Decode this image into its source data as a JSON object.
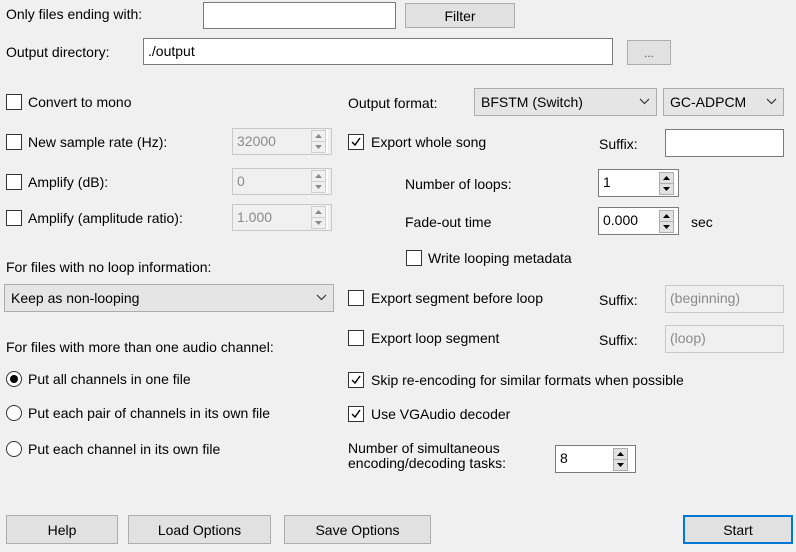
{
  "filter": {
    "label": "Only files ending with:",
    "value": "",
    "button": "Filter"
  },
  "output_dir": {
    "label": "Output directory:",
    "value": "./output",
    "browse": "..."
  },
  "convert_mono": {
    "label": "Convert to mono",
    "checked": false
  },
  "new_sample_rate": {
    "label": "New sample rate (Hz):",
    "value": "32000",
    "checked": false
  },
  "amplify_db": {
    "label": "Amplify (dB):",
    "value": "0",
    "checked": false
  },
  "amplify_ratio": {
    "label": "Amplify (amplitude ratio):",
    "value": "1.000",
    "checked": false
  },
  "no_loop": {
    "label": "For files with no loop information:",
    "selected": "Keep as non-looping"
  },
  "multi_channel": {
    "label": "For files with more than one audio channel:",
    "options": [
      "Put all channels in one file",
      "Put each pair of channels in its own file",
      "Put each channel in its own file"
    ],
    "selected_index": 0
  },
  "output_format": {
    "label": "Output format:",
    "format": "BFSTM (Switch)",
    "codec": "GC-ADPCM"
  },
  "export_whole": {
    "label": "Export whole song",
    "checked": true,
    "suffix_label": "Suffix:",
    "suffix_value": ""
  },
  "loops": {
    "label": "Number of loops:",
    "value": "1"
  },
  "fade": {
    "label": "Fade-out time",
    "value": "0.000",
    "unit": "sec"
  },
  "write_loop_meta": {
    "label": "Write looping metadata",
    "checked": false
  },
  "export_before": {
    "label": "Export segment before loop",
    "checked": false,
    "suffix_label": "Suffix:",
    "suffix_value": "(beginning)"
  },
  "export_loop": {
    "label": "Export loop segment",
    "checked": false,
    "suffix_label": "Suffix:",
    "suffix_value": "(loop)"
  },
  "skip_reencode": {
    "label": "Skip re-encoding for similar formats when possible",
    "checked": true
  },
  "vgaudio": {
    "label": "Use VGAudio decoder",
    "checked": true
  },
  "tasks": {
    "label_line1": "Number of simultaneous",
    "label_line2": "encoding/decoding tasks:",
    "value": "8"
  },
  "buttons": {
    "help": "Help",
    "load": "Load Options",
    "save": "Save Options",
    "start": "Start"
  },
  "colors": {
    "accent": "#0078d7",
    "background": "#f0f0f0"
  },
  "icons": [
    "check-icon",
    "chevron-down-icon",
    "spin-up-icon",
    "spin-down-icon"
  ]
}
